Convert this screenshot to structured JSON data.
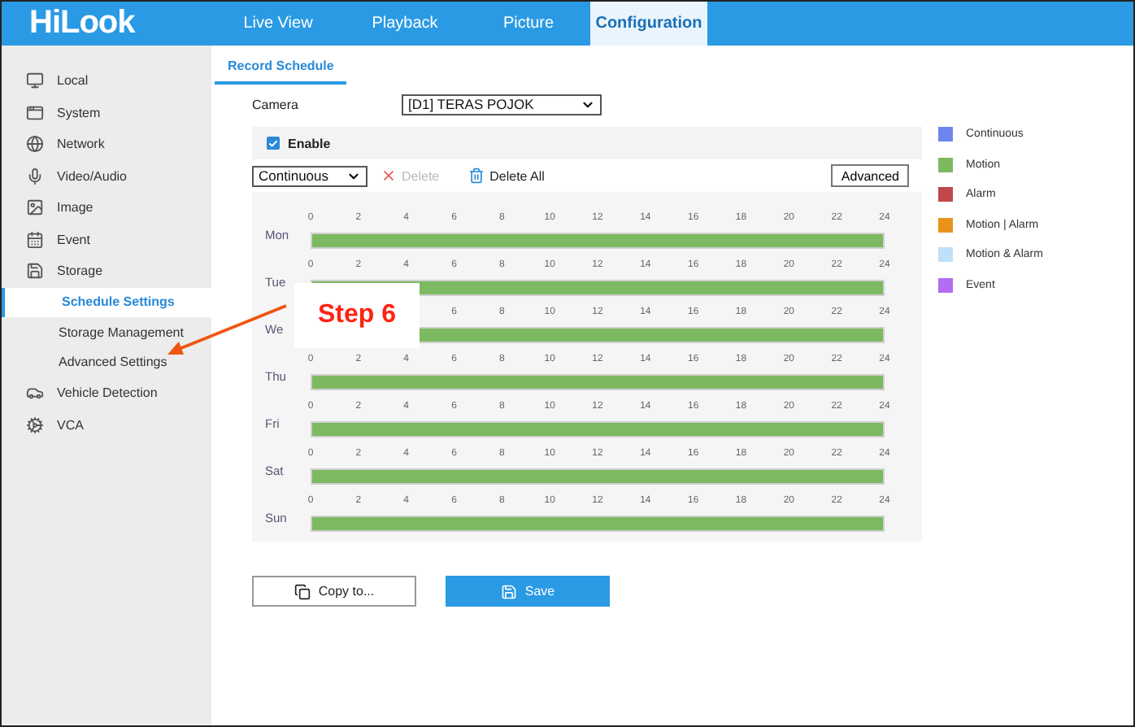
{
  "header": {
    "logo": "HiLook",
    "nav": [
      {
        "label": "Live View",
        "selected": false
      },
      {
        "label": "Playback",
        "selected": false
      },
      {
        "label": "Picture",
        "selected": false
      },
      {
        "label": "Configuration",
        "selected": true
      }
    ]
  },
  "sidebar": {
    "items": [
      {
        "label": "Local",
        "selected": false
      },
      {
        "label": "System",
        "selected": false
      },
      {
        "label": "Network",
        "selected": false
      },
      {
        "label": "Video/Audio",
        "selected": false
      },
      {
        "label": "Image",
        "selected": false
      },
      {
        "label": "Event",
        "selected": false
      },
      {
        "label": "Storage",
        "selected": false,
        "children": [
          {
            "label": "Schedule Settings",
            "selected": true
          },
          {
            "label": "Storage Management",
            "selected": false
          },
          {
            "label": "Advanced Settings",
            "selected": false
          }
        ]
      },
      {
        "label": "Vehicle Detection",
        "selected": false
      },
      {
        "label": "VCA",
        "selected": false
      }
    ]
  },
  "tabs": [
    {
      "label": "Record Schedule",
      "selected": true
    }
  ],
  "camera": {
    "label": "Camera",
    "value": "[D1] TERAS POJOK"
  },
  "enable": {
    "label": "Enable",
    "checked": true
  },
  "toolbar": {
    "mode": "Continuous",
    "delete": "Delete",
    "delete_all": "Delete All",
    "advanced": "Advanced"
  },
  "schedule": {
    "days": [
      {
        "label": "Mon",
        "color": "#7cb960",
        "ticks": [
          "0",
          "2",
          "4",
          "6",
          "8",
          "10",
          "12",
          "14",
          "16",
          "18",
          "20",
          "22",
          "24"
        ]
      },
      {
        "label": "Tue",
        "color": "#7cb960",
        "ticks": [
          "0",
          "2",
          "4",
          "6",
          "8",
          "10",
          "12",
          "14",
          "16",
          "18",
          "20",
          "22",
          "24"
        ]
      },
      {
        "label": "We",
        "color": "#7cb960",
        "ticks": [
          "6",
          "8",
          "10",
          "12",
          "14",
          "16",
          "18",
          "20",
          "22",
          "24"
        ]
      },
      {
        "label": "Thu",
        "color": "#7cb960",
        "ticks": [
          "0",
          "2",
          "4",
          "6",
          "8",
          "10",
          "12",
          "14",
          "16",
          "18",
          "20",
          "22",
          "24"
        ]
      },
      {
        "label": "Fri",
        "color": "#7cb960",
        "ticks": [
          "0",
          "2",
          "4",
          "6",
          "8",
          "10",
          "12",
          "14",
          "16",
          "18",
          "20",
          "22",
          "24"
        ]
      },
      {
        "label": "Sat",
        "color": "#7cb960",
        "ticks": [
          "0",
          "2",
          "4",
          "6",
          "8",
          "10",
          "12",
          "14",
          "16",
          "18",
          "20",
          "22",
          "24"
        ]
      },
      {
        "label": "Sun",
        "color": "#7cb960",
        "ticks": [
          "0",
          "2",
          "4",
          "6",
          "8",
          "10",
          "12",
          "14",
          "16",
          "18",
          "20",
          "22",
          "24"
        ]
      }
    ]
  },
  "legend": [
    {
      "label": "Continuous",
      "color": "#6f86ee"
    },
    {
      "label": "Motion",
      "color": "#7cb960"
    },
    {
      "label": "Alarm",
      "color": "#c0484a"
    },
    {
      "label": "Motion | Alarm",
      "color": "#e8931b"
    },
    {
      "label": "Motion & Alarm",
      "color": "#bfe0f8"
    },
    {
      "label": "Event",
      "color": "#b26df0"
    }
  ],
  "buttons": {
    "copy": "Copy to...",
    "save": "Save"
  },
  "callout": {
    "text": "Step 6"
  }
}
